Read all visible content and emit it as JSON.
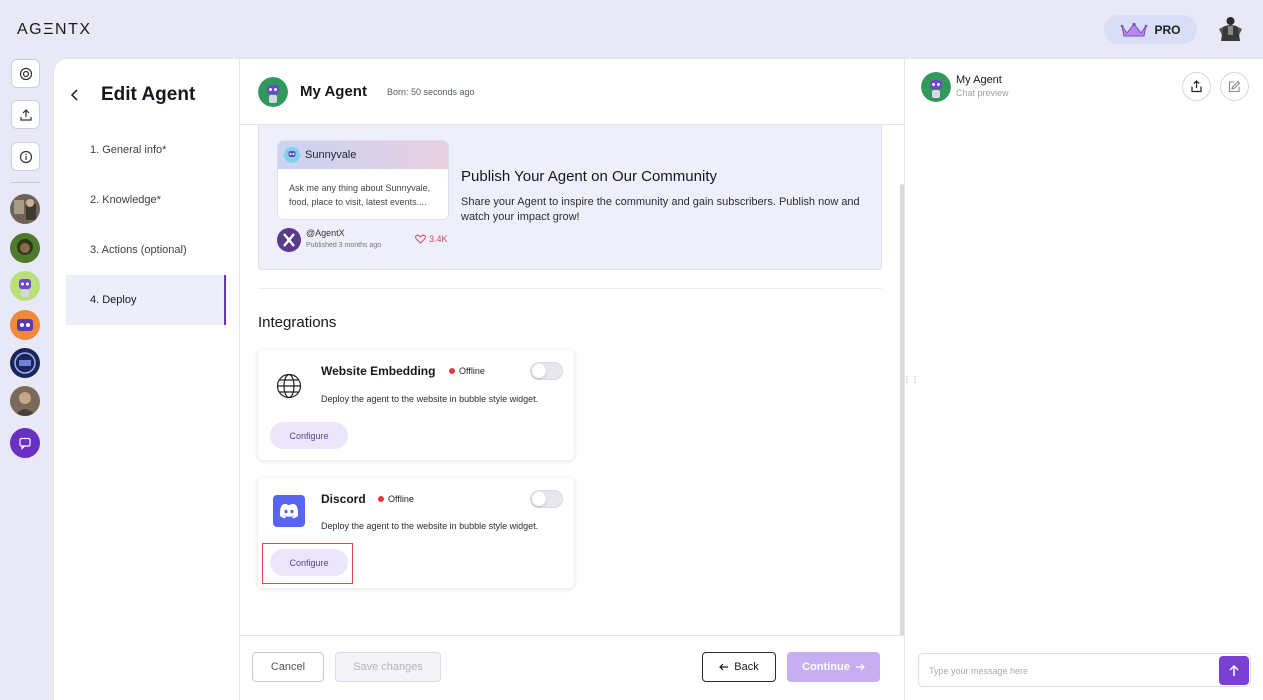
{
  "app": {
    "logo": "AGΞNTX",
    "pro_label": "PRO"
  },
  "steps": {
    "title": "Edit Agent",
    "items": [
      {
        "label": "1. General info*"
      },
      {
        "label": "2. Knowledge*"
      },
      {
        "label": "3. Actions (optional)"
      },
      {
        "label": "4. Deploy"
      }
    ]
  },
  "agent": {
    "name": "My Agent",
    "born": "Born: 50 seconds ago"
  },
  "community": {
    "card_name": "Sunnyvale",
    "card_text": "Ask me any thing about Sunnyvale, food, place to visit, latest events....",
    "author_handle": "@AgentX",
    "author_time": "Published 3 months ago",
    "likes": "3.4K",
    "title": "Publish Your Agent on Our Community",
    "desc": "Share your Agent to inspire the community and gain subscribers. Publish now and watch your impact grow!"
  },
  "integrations": {
    "title": "Integrations",
    "items": [
      {
        "name": "Website Embedding",
        "status": "Offline",
        "desc": "Deploy the agent to the website in bubble style widget.",
        "action": "Configure"
      },
      {
        "name": "Discord",
        "status": "Offline",
        "desc": "Deploy the agent to the website in bubble style widget.",
        "action": "Configure"
      }
    ]
  },
  "footer": {
    "cancel": "Cancel",
    "save": "Save changes",
    "back": "Back",
    "continue": "Continue"
  },
  "preview": {
    "name": "My Agent",
    "subtitle": "Chat preview",
    "input_placeholder": "Type your message here"
  },
  "colors": {
    "accent": "#7c3fd4",
    "offline": "#e23a3a",
    "discord": "#5865f2"
  }
}
